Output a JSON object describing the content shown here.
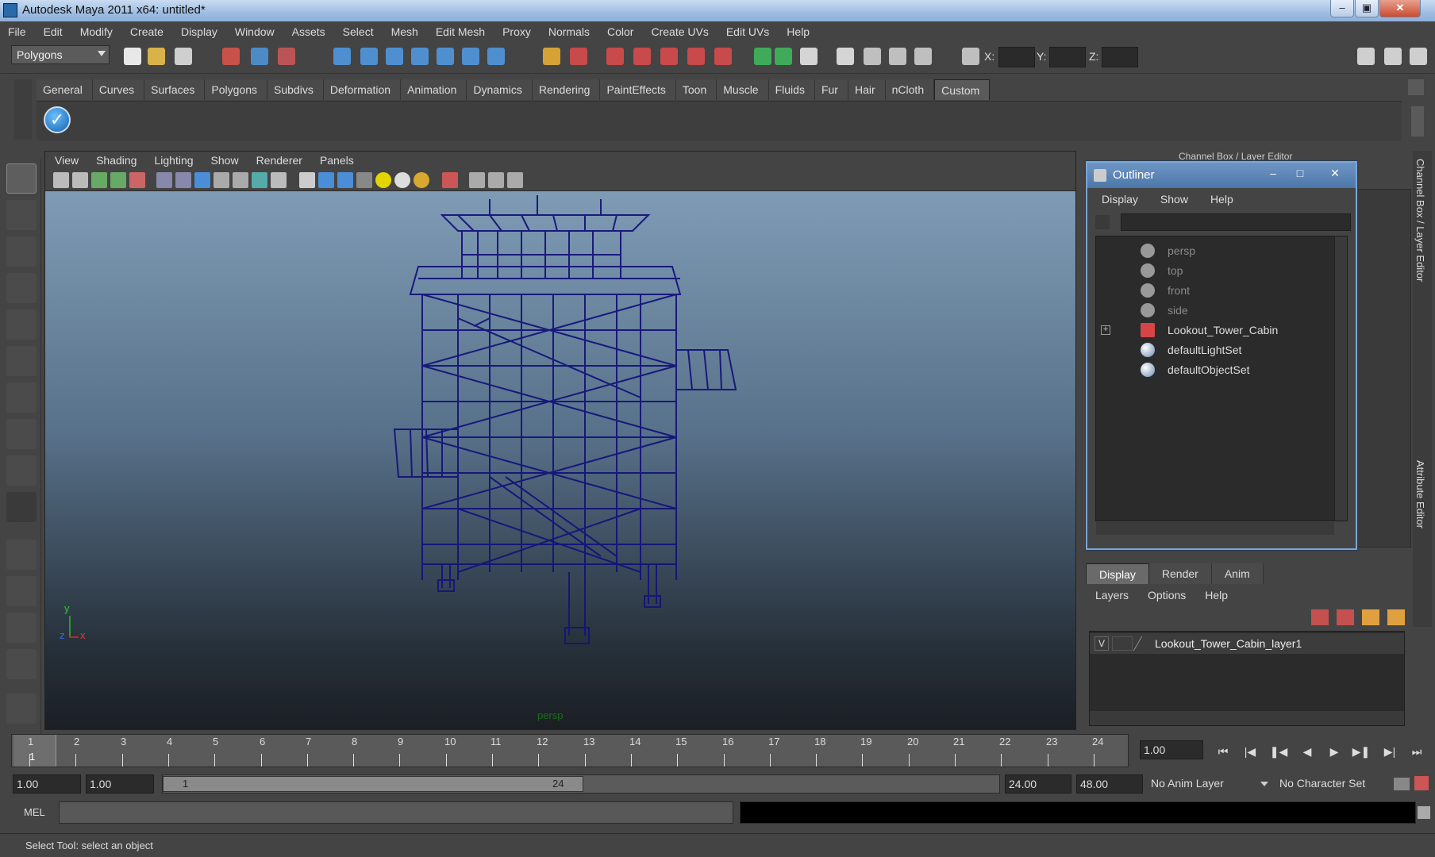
{
  "window": {
    "title": "Autodesk Maya 2011 x64: untitled*"
  },
  "menubar": [
    "File",
    "Edit",
    "Modify",
    "Create",
    "Display",
    "Window",
    "Assets",
    "Select",
    "Mesh",
    "Edit Mesh",
    "Proxy",
    "Normals",
    "Color",
    "Create UVs",
    "Edit UVs",
    "Help"
  ],
  "statusline": {
    "mode": "Polygons",
    "x_label": "X:",
    "y_label": "Y:",
    "z_label": "Z:"
  },
  "shelf": {
    "tabs": [
      "General",
      "Curves",
      "Surfaces",
      "Polygons",
      "Subdivs",
      "Deformation",
      "Animation",
      "Dynamics",
      "Rendering",
      "PaintEffects",
      "Toon",
      "Muscle",
      "Fluids",
      "Fur",
      "Hair",
      "nCloth",
      "Custom"
    ],
    "active_tab": "Custom"
  },
  "viewport": {
    "menus": [
      "View",
      "Shading",
      "Lighting",
      "Show",
      "Renderer",
      "Panels"
    ],
    "camera_label": "persp",
    "axis_y": "y",
    "axis_x": "x",
    "axis_z": "z"
  },
  "channel_box": {
    "title": "Channel Box / Layer Editor"
  },
  "side_tabs": {
    "channel_box": "Channel Box / Layer Editor",
    "attribute_editor": "Attribute Editor"
  },
  "outliner": {
    "title": "Outliner",
    "menus": [
      "Display",
      "Show",
      "Help"
    ],
    "items": [
      {
        "label": "persp",
        "icon": "camera-icon",
        "dim": true
      },
      {
        "label": "top",
        "icon": "camera-icon",
        "dim": true
      },
      {
        "label": "front",
        "icon": "camera-icon",
        "dim": true
      },
      {
        "label": "side",
        "icon": "camera-icon",
        "dim": true
      },
      {
        "label": "Lookout_Tower_Cabin",
        "icon": "mesh-icon",
        "dim": false,
        "expandable": true
      },
      {
        "label": "defaultLightSet",
        "icon": "set-icon",
        "dim": false
      },
      {
        "label": "defaultObjectSet",
        "icon": "set-icon",
        "dim": false
      }
    ]
  },
  "layer_editor": {
    "tabs": [
      "Display",
      "Render",
      "Anim"
    ],
    "active_tab": "Display",
    "menus": [
      "Layers",
      "Options",
      "Help"
    ],
    "layer": {
      "visible": "V",
      "name": "Lookout_Tower_Cabin_layer1"
    }
  },
  "timeslider": {
    "frames": [
      "1",
      "2",
      "3",
      "4",
      "5",
      "6",
      "7",
      "8",
      "9",
      "10",
      "11",
      "12",
      "13",
      "14",
      "15",
      "16",
      "17",
      "18",
      "19",
      "20",
      "21",
      "22",
      "23",
      "24"
    ],
    "current_marker": "1",
    "current_frame": "1.00"
  },
  "range": {
    "start_time": "1.00",
    "playback_start": "1.00",
    "handle_start": "1",
    "handle_end": "24",
    "playback_end": "24.00",
    "end_time": "48.00",
    "anim_layer": "No Anim Layer",
    "character_set": "No Character Set"
  },
  "commandline": {
    "label": "MEL"
  },
  "helpline": {
    "text": "Select Tool: select an object"
  },
  "colors": {
    "wireframe": "#14147a",
    "viewport_top": "#7f9bb5",
    "viewport_bottom": "#1b1f24",
    "outliner_title": "#5a84b8"
  }
}
